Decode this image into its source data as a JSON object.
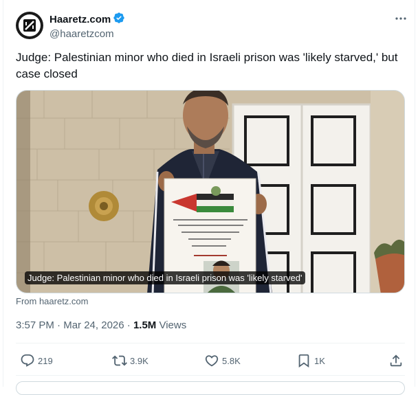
{
  "author": {
    "display_name": "Haaretz.com",
    "handle": "@haaretzcom",
    "verified": true,
    "avatar_icon": "haaretz-logo-icon"
  },
  "tweet": {
    "text": "Judge: Palestinian minor who died in Israeli prison was 'likely starved,' but case closed"
  },
  "media": {
    "caption": "Judge: Palestinian minor who died in Israeli prison was 'likely starved'"
  },
  "link_source": "From haaretz.com",
  "meta": {
    "time": "3:57 PM",
    "separator": " · ",
    "date": "Mar 24, 2026",
    "views_count": "1.5M",
    "views_label": "Views"
  },
  "actions": {
    "replies": "219",
    "reposts": "3.9K",
    "likes": "5.8K",
    "bookmarks": "1K"
  },
  "colors": {
    "verified_badge": "#1d9bf0",
    "text_primary": "#0f1419",
    "text_secondary": "#536471"
  }
}
